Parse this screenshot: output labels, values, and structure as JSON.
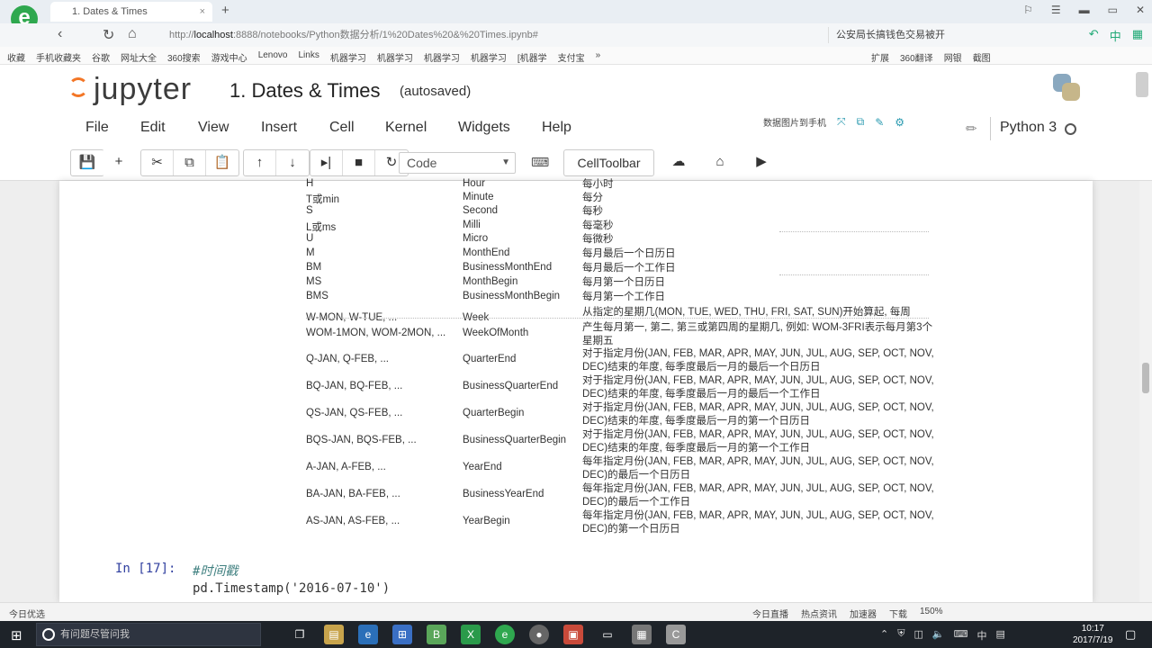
{
  "browser": {
    "tab_title": "1. Dates & Times",
    "tab_close": "×",
    "new_tab": "+",
    "url_prefix": "http://",
    "url_host": "localhost",
    "url_rest": ":8888/notebooks/Python数据分析/1%20Dates%20&%20Times.ipynb#",
    "search_text": "公安局长搞钱色交易被开",
    "bookmarks": [
      "收藏",
      "手机收藏夹",
      "谷歌",
      "网址大全",
      "360搜索",
      "游戏中心",
      "Lenovo",
      "Links",
      "机器学习",
      "机器学习",
      "机器学习",
      "机器学习",
      "[机器学",
      "支付宝",
      "»"
    ],
    "bookmarks_right": [
      "扩展",
      "360翻译",
      "网银",
      "截图"
    ],
    "status_left": "今日优选",
    "status_right": [
      "今日直播",
      "热点资讯",
      "加速器",
      "下载",
      "150%"
    ]
  },
  "jupyter": {
    "logo_text": "jupyter",
    "notebook_title": "1. Dates & Times",
    "save_status": "(autosaved)",
    "menu": [
      "File",
      "Edit",
      "View",
      "Insert",
      "Cell",
      "Kernel",
      "Widgets",
      "Help"
    ],
    "menu_extra_label": "数据图片到手机",
    "kernel_name": "Python 3",
    "cell_type": "Code",
    "cell_toolbar_label": "CellToolbar"
  },
  "freq_table": [
    {
      "alias": "H",
      "offset": "Hour",
      "desc": "每小时"
    },
    {
      "alias": "T或min",
      "offset": "Minute",
      "desc": "每分"
    },
    {
      "alias": "S",
      "offset": "Second",
      "desc": "每秒"
    },
    {
      "alias": "L或ms",
      "offset": "Milli",
      "desc": "每毫秒"
    },
    {
      "alias": "U",
      "offset": "Micro",
      "desc": "每微秒"
    },
    {
      "alias": "M",
      "offset": "MonthEnd",
      "desc": "每月最后一个日历日"
    },
    {
      "alias": "BM",
      "offset": "BusinessMonthEnd",
      "desc": "每月最后一个工作日"
    },
    {
      "alias": "MS",
      "offset": "MonthBegin",
      "desc": "每月第一个日历日"
    },
    {
      "alias": "BMS",
      "offset": "BusinessMonthBegin",
      "desc": "每月第一个工作日"
    },
    {
      "alias": "W-MON, W-TUE, ...",
      "offset": "Week",
      "desc": "从指定的星期几(MON, TUE, WED, THU, FRI, SAT, SUN)开始算起, 每周"
    },
    {
      "alias": "WOM-1MON, WOM-2MON, ...",
      "offset": "WeekOfMonth",
      "desc": "产生每月第一, 第二, 第三或第四周的星期几, 例如: WOM-3FRI表示每月第3个星期五"
    },
    {
      "alias": "Q-JAN, Q-FEB, ...",
      "offset": "QuarterEnd",
      "desc": "对于指定月份(JAN, FEB, MAR, APR, MAY, JUN, JUL, AUG, SEP, OCT, NOV, DEC)结束的年度, 每季度最后一月的最后一个日历日"
    },
    {
      "alias": "BQ-JAN, BQ-FEB, ...",
      "offset": "BusinessQuarterEnd",
      "desc": "对于指定月份(JAN, FEB, MAR, APR, MAY, JUN, JUL, AUG, SEP, OCT, NOV, DEC)结束的年度, 每季度最后一月的最后一个工作日"
    },
    {
      "alias": "QS-JAN, QS-FEB, ...",
      "offset": "QuarterBegin",
      "desc": "对于指定月份(JAN, FEB, MAR, APR, MAY, JUN, JUL, AUG, SEP, OCT, NOV, DEC)结束的年度, 每季度最后一月的第一个日历日"
    },
    {
      "alias": "BQS-JAN, BQS-FEB, ...",
      "offset": "BusinessQuarterBegin",
      "desc": "对于指定月份(JAN, FEB, MAR, APR, MAY, JUN, JUL, AUG, SEP, OCT, NOV, DEC)结束的年度, 每季度最后一月的第一个工作日"
    },
    {
      "alias": "A-JAN, A-FEB, ...",
      "offset": "YearEnd",
      "desc": "每年指定月份(JAN, FEB, MAR, APR, MAY, JUN, JUL, AUG, SEP, OCT, NOV, DEC)的最后一个日历日"
    },
    {
      "alias": "BA-JAN, BA-FEB, ...",
      "offset": "BusinessYearEnd",
      "desc": "每年指定月份(JAN, FEB, MAR, APR, MAY, JUN, JUL, AUG, SEP, OCT, NOV, DEC)的最后一个工作日"
    },
    {
      "alias": "AS-JAN, AS-FEB, ...",
      "offset": "YearBegin",
      "desc": "每年指定月份(JAN, FEB, MAR, APR, MAY, JUN, JUL, AUG, SEP, OCT, NOV, DEC)的第一个日历日"
    }
  ],
  "code_cell": {
    "prompt": "In [17]:",
    "line1": "#时间戳",
    "line2": "pd.Timestamp('2016-07-10')"
  },
  "taskbar": {
    "search_placeholder": "有问题尽管问我",
    "clock_time": "10:17",
    "clock_date": "2017/7/19",
    "ime": "中"
  },
  "colors": {
    "jupyter_orange": "#f37626",
    "prompt_blue": "#303f9f",
    "comment_teal": "#408080",
    "taskbar_bg": "#1e2329"
  }
}
